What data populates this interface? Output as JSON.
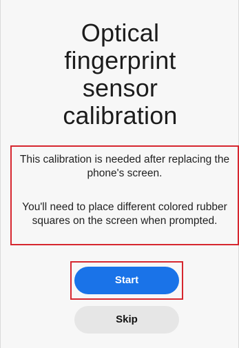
{
  "title": "Optical\nfingerprint\nsensor\ncalibration",
  "description": {
    "para1": "This calibration is needed after replacing the phone's screen.",
    "para2": "You'll need to place different colored rubber squares on the screen when prompted."
  },
  "buttons": {
    "start_label": "Start",
    "skip_label": "Skip"
  },
  "colors": {
    "accent": "#1a73e8",
    "highlight": "#d6262e",
    "secondary_button": "#e6e6e6"
  }
}
